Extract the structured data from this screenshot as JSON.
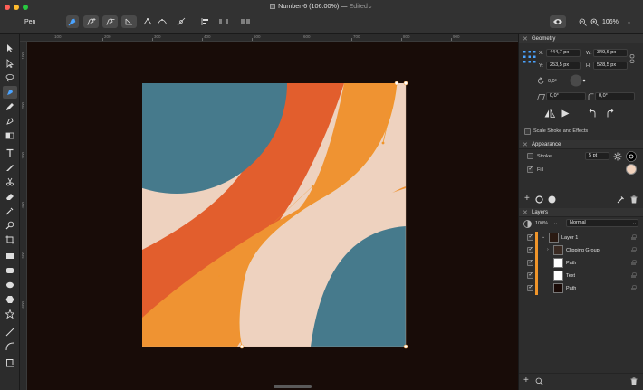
{
  "window": {
    "title": "Number-6 (106.00%)",
    "title_separator": "—",
    "status": "Edited",
    "status_chevron": "⌄",
    "traffic_lights": [
      "#ff5f57",
      "#febc2e",
      "#28c840"
    ]
  },
  "toolbar": {
    "tool_name": "Pen",
    "zoom": "106%"
  },
  "ruler": {
    "top_labels": [
      "100",
      "200",
      "300",
      "400",
      "500",
      "600",
      "700",
      "800",
      "900"
    ],
    "left_labels": [
      "100",
      "200",
      "300",
      "400",
      "500",
      "600"
    ]
  },
  "geometry": {
    "title": "Geometry",
    "x_label": "X:",
    "x_value": "444,7 px",
    "y_label": "Y:",
    "y_value": "253,5 px",
    "w_label": "W:",
    "w_value": "349,6 px",
    "h_label": "H:",
    "h_value": "528,5 px",
    "rotation": "0,0°",
    "shear": "0,0°",
    "corner": "0,0°",
    "scale_stroke_label": "Scale Stroke and Effects"
  },
  "appearance": {
    "title": "Appearance",
    "stroke_label": "Stroke",
    "stroke_width": "5 pt",
    "fill_label": "Fill",
    "fill_color": "#f1d2bd"
  },
  "layers": {
    "title": "Layers",
    "opacity": "100%",
    "blend_mode": "Normal",
    "items": [
      {
        "name": "Layer 1",
        "visible": true
      },
      {
        "name": "Clipping Group",
        "visible": true
      },
      {
        "name": "Path",
        "visible": true
      },
      {
        "name": "Text",
        "visible": true
      },
      {
        "name": "Path",
        "visible": true
      }
    ]
  },
  "artwork_colors": {
    "teal": "#467a8c",
    "peach": "#eed2bf",
    "orange_red": "#e25e2d",
    "orange": "#ef9332",
    "canvas_bg": "#180c08",
    "selection": "#f0952a"
  }
}
